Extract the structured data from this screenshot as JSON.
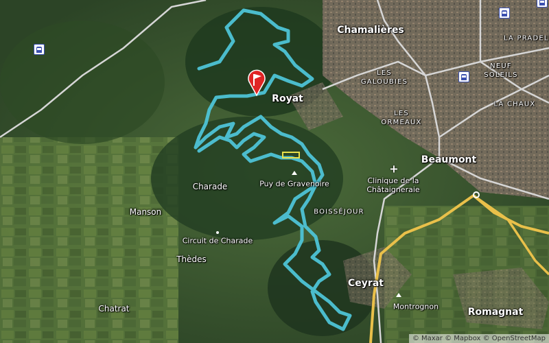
{
  "map": {
    "style": "satellite",
    "route_color": "#4ec3d6",
    "road_color": "#d6d6d6",
    "highway_color": "#e9c04a"
  },
  "places": {
    "chamalieres": "Chamalières",
    "la_pradelle": "LA PRADELLE",
    "neuf_soleils": "NEUF SOLEILS",
    "les_galoubies": "LES GALOUBIES",
    "royat": "Royat",
    "la_chaux": "LA CHAUX",
    "les_ormeaux": "LES ORMEAUX",
    "beaumont": "Beaumont",
    "charade": "Charade",
    "puy_de_gravenoire": "Puy de Gravenoire",
    "clinique": "Clinique de la Châtaigneraie",
    "boissejour": "BOISSÉJOUR",
    "manson": "Manson",
    "circuit_de_charade": "Circuit de Charade",
    "thedes": "Thèdes",
    "ceyrat": "Ceyrat",
    "montrognon": "Montrognon",
    "romagnat": "Romagnat",
    "chatrat": "Chatrat"
  },
  "attribution": "© Maxar © Mapbox © OpenStreetMap",
  "markers": {
    "start_flag": "start-flag",
    "train_stations": 4,
    "hospital": "hospital-icon",
    "peak": "peak-icon"
  }
}
